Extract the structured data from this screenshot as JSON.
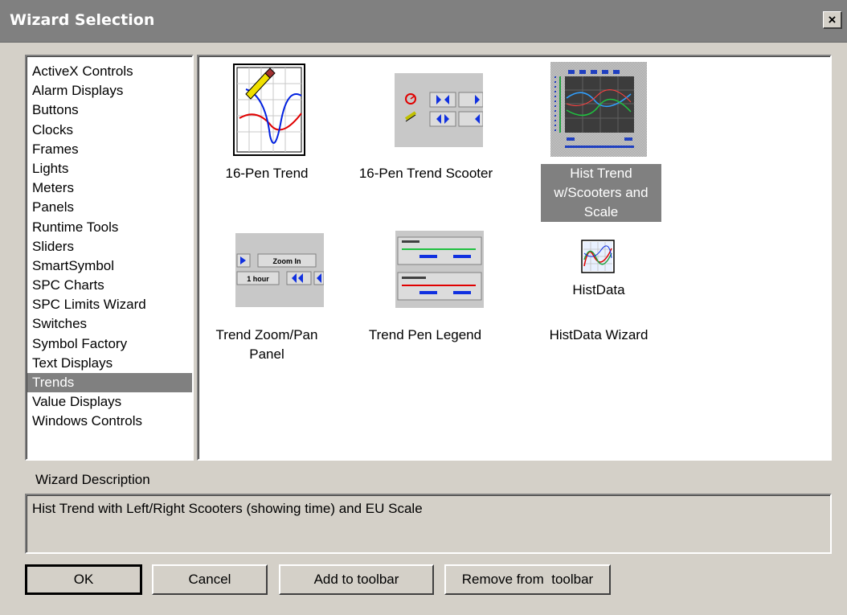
{
  "window": {
    "title": "Wizard Selection",
    "close_glyph": "×"
  },
  "categories": [
    "ActiveX Controls",
    "Alarm Displays",
    "Buttons",
    "Clocks",
    "Frames",
    "Lights",
    "Meters",
    "Panels",
    "Runtime Tools",
    "Sliders",
    "SmartSymbol",
    "SPC Charts",
    "SPC Limits Wizard",
    "Switches",
    "Symbol Factory",
    "Text Displays",
    "Trends",
    "Value Displays",
    "Windows Controls"
  ],
  "selected_category": "Trends",
  "wizards": [
    {
      "icon": "pen-trend-icon",
      "label": "16-Pen Trend"
    },
    {
      "icon": "pen-trend-scooter-icon",
      "label": "16-Pen Trend Scooter",
      "thumb_text": []
    },
    {
      "icon": "hist-trend-scale-icon",
      "label": "Hist Trend w/Scooters and Scale",
      "selected": true
    },
    {
      "icon": "zoom-pan-panel-icon",
      "label": "Trend Zoom/Pan Panel",
      "thumb_text": [
        "Zoom In",
        "1 hour"
      ]
    },
    {
      "icon": "pen-legend-icon",
      "label": "Trend Pen Legend"
    },
    {
      "icon": "histdata-icon",
      "label": "HistData Wizard",
      "thumb_caption": "HistData"
    }
  ],
  "description": {
    "caption": "Wizard Description",
    "text": "Hist Trend with Left/Right Scooters (showing time) and EU Scale"
  },
  "buttons": {
    "ok": "OK",
    "cancel": "Cancel",
    "add": "Add to toolbar",
    "remove": "Remove from  toolbar"
  }
}
